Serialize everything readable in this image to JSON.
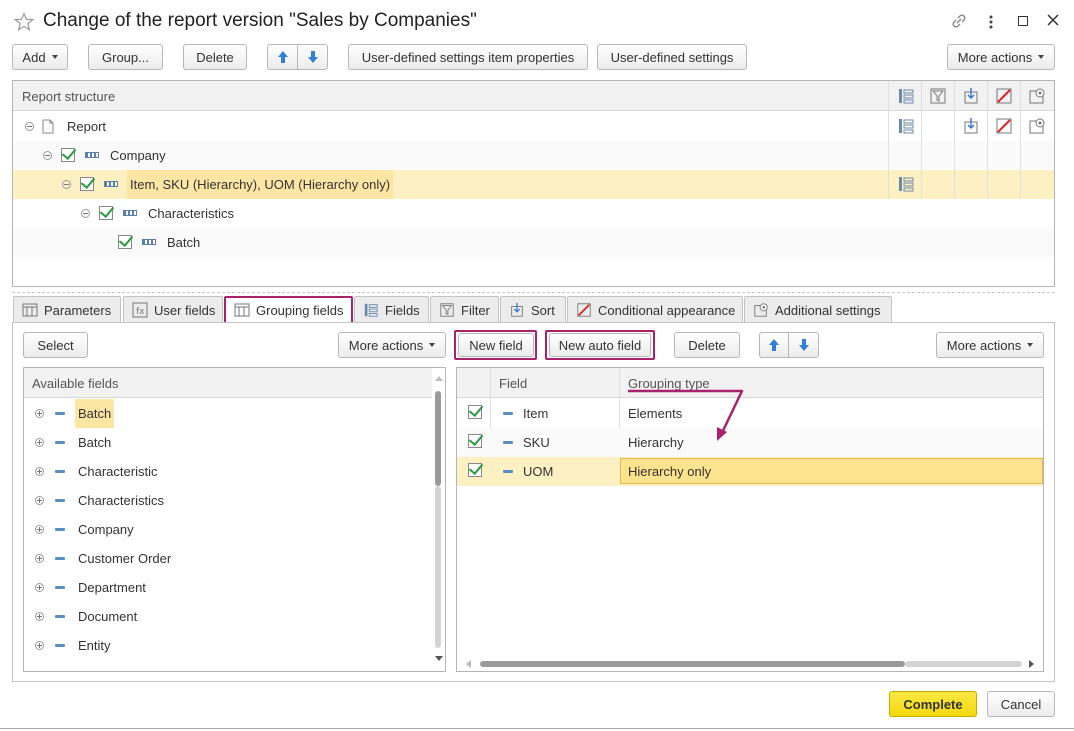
{
  "window": {
    "title": "Change of the report version \"Sales by Companies\""
  },
  "toolbar": {
    "add_label": "Add",
    "group_label": "Group...",
    "delete_label": "Delete",
    "item_props_label": "User-defined settings item properties",
    "user_settings_label": "User-defined settings",
    "more_actions_label": "More actions"
  },
  "structure": {
    "header": "Report structure",
    "rows": [
      {
        "label": "Report"
      },
      {
        "label": "Company"
      },
      {
        "label": "Item, SKU (Hierarchy), UOM (Hierarchy only)"
      },
      {
        "label": "Characteristics"
      },
      {
        "label": "Batch"
      }
    ]
  },
  "tabs": [
    {
      "label": "Parameters"
    },
    {
      "label": "User fields"
    },
    {
      "label": "Grouping fields"
    },
    {
      "label": "Fields"
    },
    {
      "label": "Filter"
    },
    {
      "label": "Sort"
    },
    {
      "label": "Conditional appearance"
    },
    {
      "label": "Additional settings"
    }
  ],
  "left_panel": {
    "select_label": "Select",
    "more_actions_label": "More actions",
    "header": "Available fields",
    "items": [
      "Batch",
      "Batch",
      "Characteristic",
      "Characteristics",
      "Company",
      "Customer Order",
      "Department",
      "Document",
      "Entity"
    ]
  },
  "right_panel": {
    "new_field_label": "New field",
    "new_auto_field_label": "New auto field",
    "delete_label": "Delete",
    "more_actions_label": "More actions",
    "col_field": "Field",
    "col_grouping": "Grouping type",
    "rows": [
      {
        "field": "Item",
        "grouping": "Elements"
      },
      {
        "field": "SKU",
        "grouping": "Hierarchy"
      },
      {
        "field": "UOM",
        "grouping": "Hierarchy only"
      }
    ]
  },
  "footer": {
    "complete_label": "Complete",
    "cancel_label": "Cancel"
  },
  "colors": {
    "highlight_row": "#fdf0c2",
    "annotation": "#a8236b",
    "complete_button": "#f7e01e"
  }
}
